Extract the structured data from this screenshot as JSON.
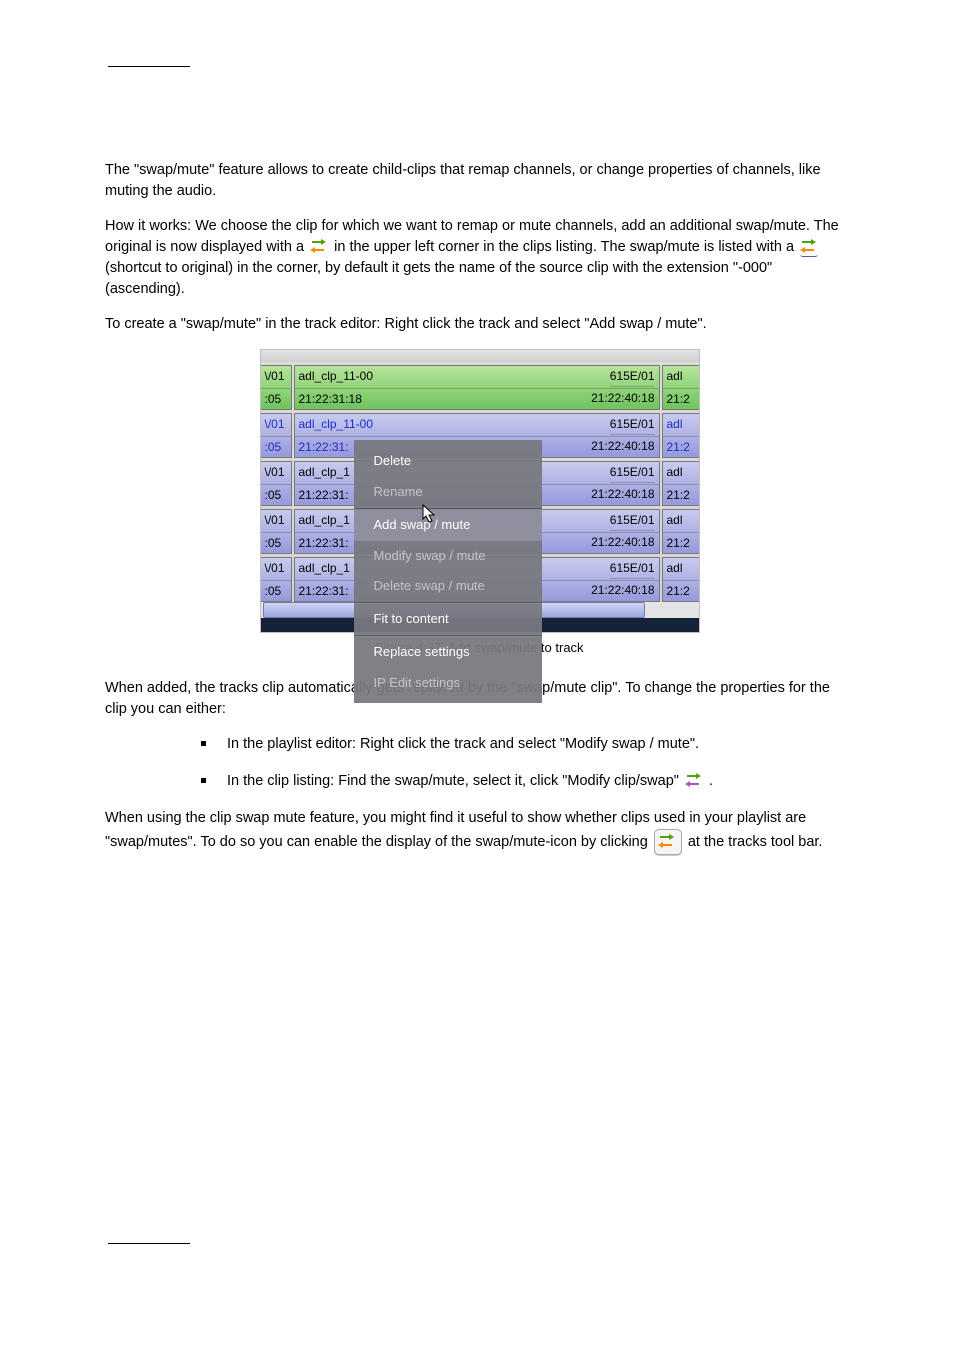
{
  "intro": {
    "p1": "The \"swap/mute\" feature allows to create child-clips that remap channels, or change properties of channels, like muting the audio.",
    "p2a": "How it works: We choose the clip for which we want to remap or mute channels, add an additional swap/mute. The original is now displayed with a ",
    "p2b_mid": " in the upper left corner in the clips listing. The swap/mute is listed with a ",
    "p2c_link": "(shortcut to original)",
    "p2d": " in the corner, by default it gets the name of the source clip with the extension \"-000\" (ascending).",
    "p3": "To create a \"swap/mute\" in the track editor: Right click the track and select \"Add swap / mute\"."
  },
  "screenshot": {
    "tracks": [
      {
        "left_t": "\\/01",
        "left_b": ":05",
        "clip_t": "adl_clp_11-00",
        "clip_b": "21:22:31:18",
        "endr_t": "615E/01",
        "endr_b": "21:22:40:18",
        "right_t": "adl",
        "right_b": "21:2"
      },
      {
        "left_t": "\\/01",
        "left_b": ":05",
        "clip_t": "adl_clp_11-00",
        "clip_b": "21:22:31:",
        "endr_t": "615E/01",
        "endr_b": "21:22:40:18",
        "right_t": "adl",
        "right_b": "21:2"
      },
      {
        "left_t": "\\/01",
        "left_b": ":05",
        "clip_t": "adl_clp_1",
        "clip_b": "21:22:31:",
        "endr_t": "615E/01",
        "endr_b": "21:22:40:18",
        "right_t": "adl",
        "right_b": "21:2"
      },
      {
        "left_t": "\\/01",
        "left_b": ":05",
        "clip_t": "adl_clp_1",
        "clip_b": "21:22:31:",
        "endr_t": "615E/01",
        "endr_b": "21:22:40:18",
        "right_t": "adl",
        "right_b": "21:2"
      },
      {
        "left_t": "\\/01",
        "left_b": ":05",
        "clip_t": "adl_clp_1",
        "clip_b": "21:22:31:",
        "endr_t": "615E/01",
        "endr_b": "21:22:40:18",
        "right_t": "adl",
        "right_b": "21:2"
      }
    ],
    "ctx": {
      "delete": "Delete",
      "rename": "Rename",
      "add": "Add swap / mute",
      "modify": "Modify swap / mute",
      "del": "Delete swap / mute",
      "fit": "Fit to content",
      "replace": "Replace settings",
      "ip": "IP Edit settings"
    }
  },
  "caption": "Figure 4.37. Add swap/mute to track",
  "after": {
    "p1": "When added, the tracks clip automatically gets replaced by the \"swap/mute clip\". To change the properties for the clip you can either:",
    "b1": "In the playlist editor: Right click the track and select \"Modify swap / mute\".",
    "b2a": "In the clip listing: Find the swap/mute, select it, click \"Modify clip/swap\" ",
    "b2b": ".",
    "p2a": "When using the clip swap mute feature, you might find it useful to show whether clips used in your playlist are \"swap/mutes\". To do so you can enable the display of the swap/mute-icon by clicking ",
    "p2b": " at the tracks tool bar."
  }
}
